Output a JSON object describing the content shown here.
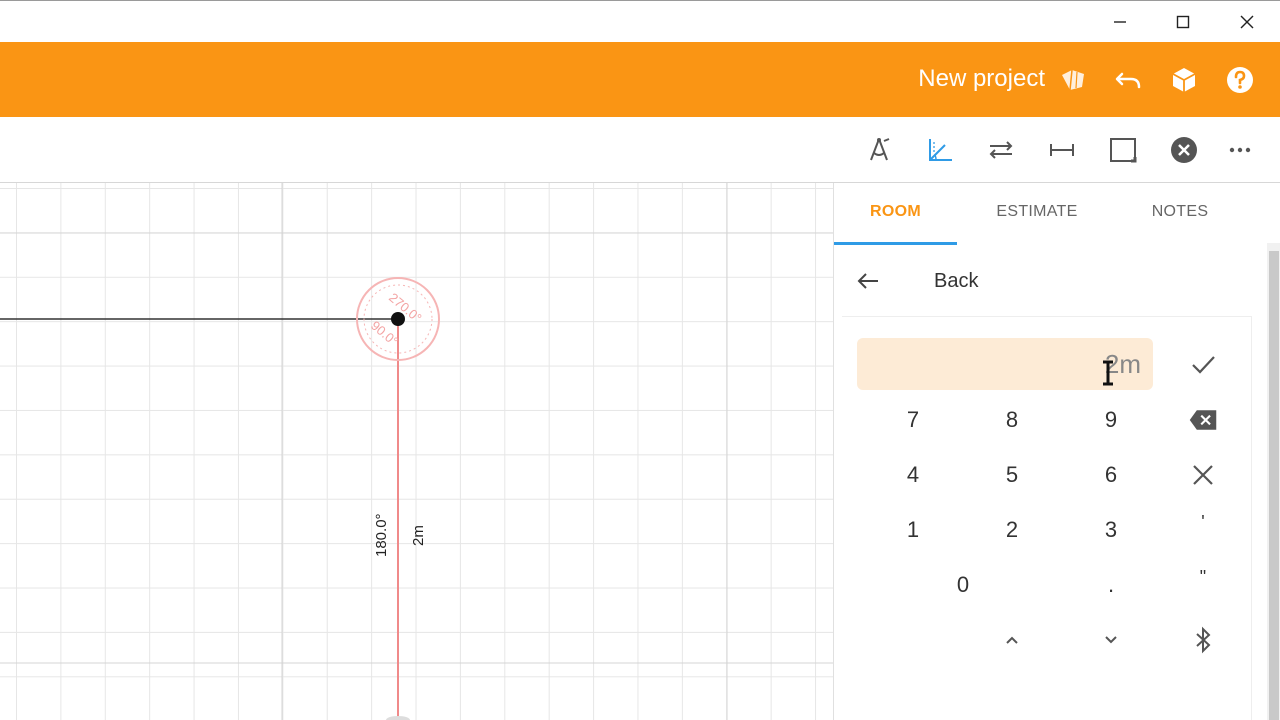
{
  "window": {
    "controls": {
      "minimize": "minimize-icon",
      "maximize": "maximize-icon",
      "close": "close-icon"
    }
  },
  "appbar": {
    "title": "New project",
    "background_color": "#fa9514",
    "icons": [
      "project-icon",
      "undo-icon",
      "3d-view-icon",
      "help-icon"
    ]
  },
  "toolbar": {
    "tools": [
      "compass-draw-icon",
      "angle-tool-icon",
      "swap-direction-icon",
      "dimension-icon",
      "square-room-icon",
      "cancel-circle-icon",
      "more-icon"
    ],
    "active_tool": "angle-tool-icon",
    "active_color": "#2f9be6"
  },
  "canvas": {
    "angle_dial_labels": [
      "270.0°",
      "90.0°"
    ],
    "wall_angle": "180.0°",
    "wall_length": "2m",
    "active_wall_color": "#f08a8a"
  },
  "panel": {
    "tabs": [
      {
        "label": "ROOM",
        "active": true
      },
      {
        "label": "ESTIMATE",
        "active": false
      },
      {
        "label": "NOTES",
        "active": false
      }
    ],
    "back_label": "Back",
    "input": {
      "value": "2m"
    },
    "keypad": {
      "rows": [
        [
          "7",
          "8",
          "9"
        ],
        [
          "4",
          "5",
          "6"
        ],
        [
          "1",
          "2",
          "3"
        ],
        [
          "0",
          "."
        ]
      ],
      "side_keys": [
        "confirm-check-icon",
        "backspace-icon",
        "clear-x-icon",
        "'",
        "\"",
        "bluetooth-icon"
      ],
      "arrow_keys": [
        "chevron-up-icon",
        "chevron-down-icon"
      ]
    }
  }
}
